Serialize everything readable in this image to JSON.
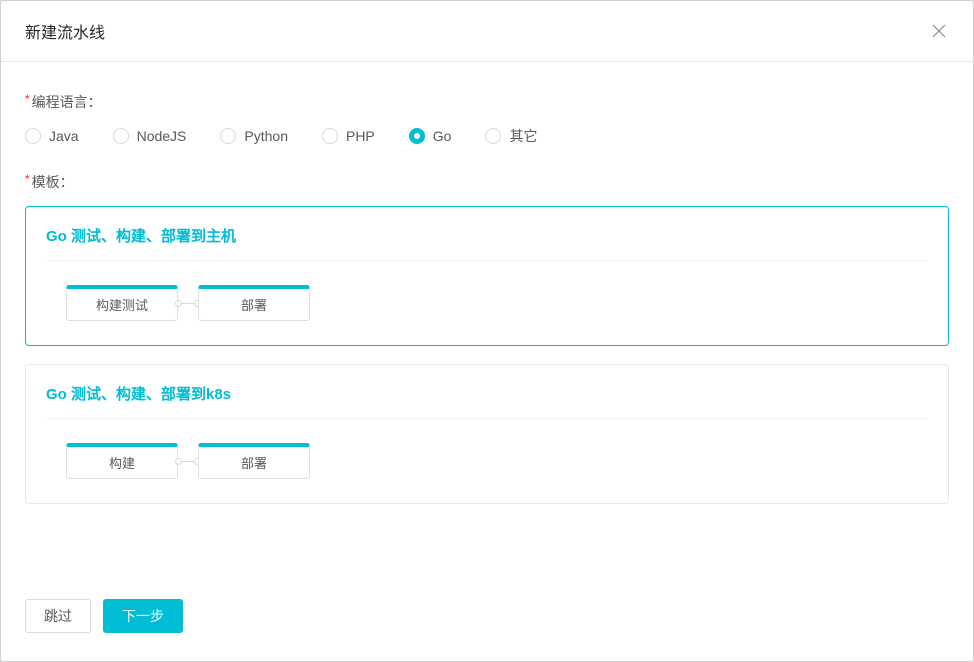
{
  "modal": {
    "title": "新建流水线"
  },
  "form": {
    "language": {
      "label": "编程语言：",
      "options": [
        {
          "value": "java",
          "label": "Java",
          "checked": false
        },
        {
          "value": "nodejs",
          "label": "NodeJS",
          "checked": false
        },
        {
          "value": "python",
          "label": "Python",
          "checked": false
        },
        {
          "value": "php",
          "label": "PHP",
          "checked": false
        },
        {
          "value": "go",
          "label": "Go",
          "checked": true
        },
        {
          "value": "other",
          "label": "其它",
          "checked": false
        }
      ]
    },
    "template": {
      "label": "模板：",
      "options": [
        {
          "title": "Go 测试、构建、部署到主机",
          "selected": true,
          "steps": [
            "构建测试",
            "部署"
          ]
        },
        {
          "title": "Go 测试、构建、部署到k8s",
          "selected": false,
          "steps": [
            "构建",
            "部署"
          ]
        }
      ]
    }
  },
  "footer": {
    "skip_label": "跳过",
    "next_label": "下一步"
  }
}
